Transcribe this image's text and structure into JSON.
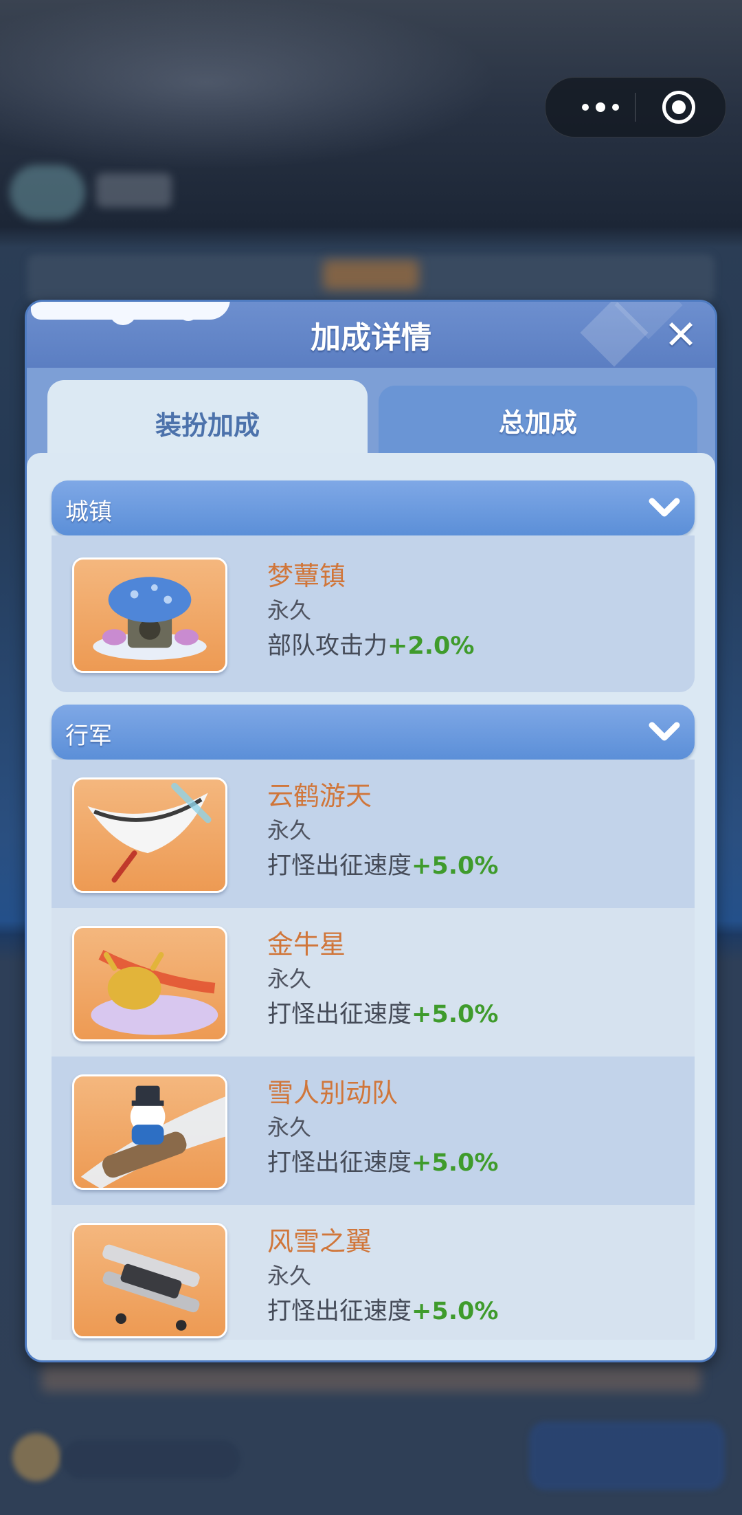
{
  "modal": {
    "title": "加成详情",
    "close_glyph": "✕",
    "tabs": [
      {
        "label": "装扮加成",
        "active": true
      },
      {
        "label": "总加成",
        "active": false
      }
    ]
  },
  "sections": [
    {
      "label": "城镇",
      "chevron_icon": "chevron-down-icon",
      "items": [
        {
          "name": "梦蕈镇",
          "duration": "永久",
          "effect_label": "部队攻击力",
          "effect_value": "+2.0%",
          "icon": "mushroom-town-icon"
        }
      ]
    },
    {
      "label": "行军",
      "chevron_icon": "chevron-down-icon",
      "items": [
        {
          "name": "云鹤游天",
          "duration": "永久",
          "effect_label": "打怪出征速度",
          "effect_value": "+5.0%",
          "icon": "crane-icon"
        },
        {
          "name": "金牛星",
          "duration": "永久",
          "effect_label": "打怪出征速度",
          "effect_value": "+5.0%",
          "icon": "golden-bull-icon"
        },
        {
          "name": "雪人别动队",
          "duration": "永久",
          "effect_label": "打怪出征速度",
          "effect_value": "+5.0%",
          "icon": "snowman-icon"
        },
        {
          "name": "风雪之翼",
          "duration": "永久",
          "effect_label": "打怪出征速度",
          "effect_value": "+5.0%",
          "icon": "snow-plane-icon"
        }
      ]
    }
  ],
  "colors": {
    "accent_blue": "#5b8fd8",
    "item_name": "#d0763a",
    "effect_value": "#3f9b2c"
  }
}
